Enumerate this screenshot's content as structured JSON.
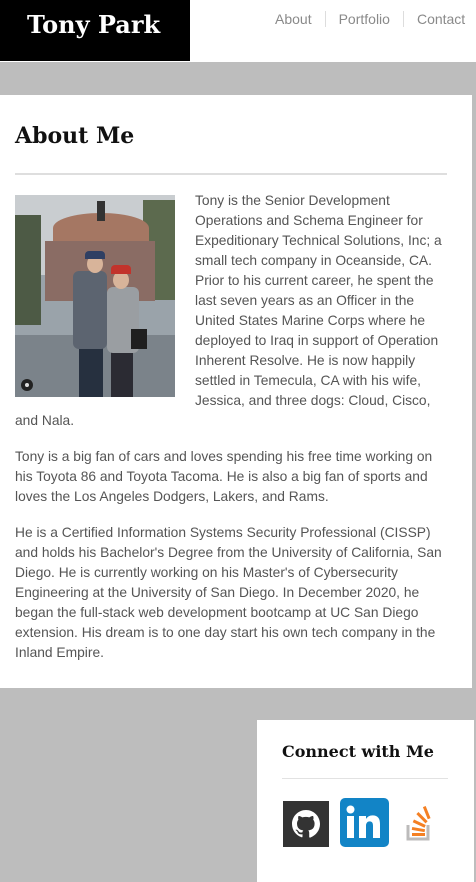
{
  "header": {
    "brand": "Tony Park",
    "nav": [
      "About",
      "Portfolio",
      "Contact"
    ]
  },
  "about": {
    "title": "About Me",
    "photo_alt": "Tony and Jessica",
    "paragraphs": [
      "Tony is the Senior Development Operations and Schema Engineer for Expeditionary Technical Solutions, Inc; a small tech company in Oceanside, CA. Prior to his current career, he spent the last seven years as an Officer in the United States Marine Corps where he deployed to Iraq in support of Operation Inherent Resolve. He is now happily settled in Temecula, CA with his wife, Jessica, and three dogs: Cloud, Cisco, and Nala.",
      "Tony is a big fan of cars and loves spending his free time working on his Toyota 86 and Toyota Tacoma. He is also a big fan of sports and loves the Los Angeles Dodgers, Lakers, and Rams.",
      "He is a Certified Information Systems Security Professional (CISSP) and holds his Bachelor's Degree from the University of California, San Diego. He is currently working on his Master's of Cybersecurity Engineering at the University of San Diego. In December 2020, he began the full-stack web development bootcamp at UC San Diego extension. His dream is to one day start his own tech company in the Inland Empire."
    ]
  },
  "connect": {
    "title": "Connect with Me",
    "links": [
      {
        "icon": "github-icon"
      },
      {
        "icon": "linkedin-icon"
      },
      {
        "icon": "stackoverflow-icon"
      }
    ]
  },
  "colors": {
    "brand_bg": "#000000",
    "page_bg": "#bdbdbd",
    "linkedin": "#1284c6",
    "stackoverflow": "#f48024"
  }
}
